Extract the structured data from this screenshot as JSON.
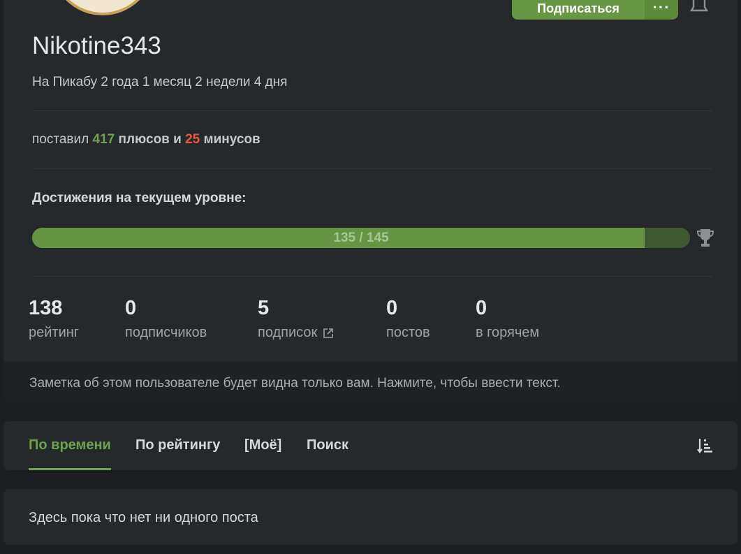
{
  "profile": {
    "subscribe_label": "Подписаться",
    "more_label": "···",
    "username": "Nikotine343",
    "since": "На Пикабу 2 года 1 месяц 2 недели 4 дня",
    "votes": {
      "prefix": "поставил",
      "plus_count": "417",
      "plus_word": "плюсов и",
      "minus_count": "25",
      "minus_word": "минусов"
    },
    "achievements": {
      "title": "Достижения на текущем уровне:",
      "progress_text": "135 / 145",
      "current": 135,
      "total": 145
    },
    "stats": [
      {
        "value": "138",
        "label": "рейтинг"
      },
      {
        "value": "0",
        "label": "подписчиков"
      },
      {
        "value": "5",
        "label": "подписок"
      },
      {
        "value": "0",
        "label": "постов"
      },
      {
        "value": "0",
        "label": "в горячем"
      }
    ]
  },
  "note": {
    "placeholder": "Заметка об этом пользователе будет видна только вам. Нажмите, чтобы ввести текст."
  },
  "tabs": [
    {
      "label": "По времени",
      "active": true
    },
    {
      "label": "По рейтингу",
      "active": false
    },
    {
      "label": "[Моё]",
      "active": false
    },
    {
      "label": "Поиск",
      "active": false
    }
  ],
  "posts": {
    "empty_text": "Здесь пока что нет ни одного поста"
  },
  "colors": {
    "accent_green": "#6da34d",
    "minus_red": "#e8573d",
    "background": "#1c1e21",
    "card": "#26292c"
  },
  "icons": [
    "bell-icon",
    "trophy-icon",
    "external-link-icon",
    "sort-icon"
  ]
}
